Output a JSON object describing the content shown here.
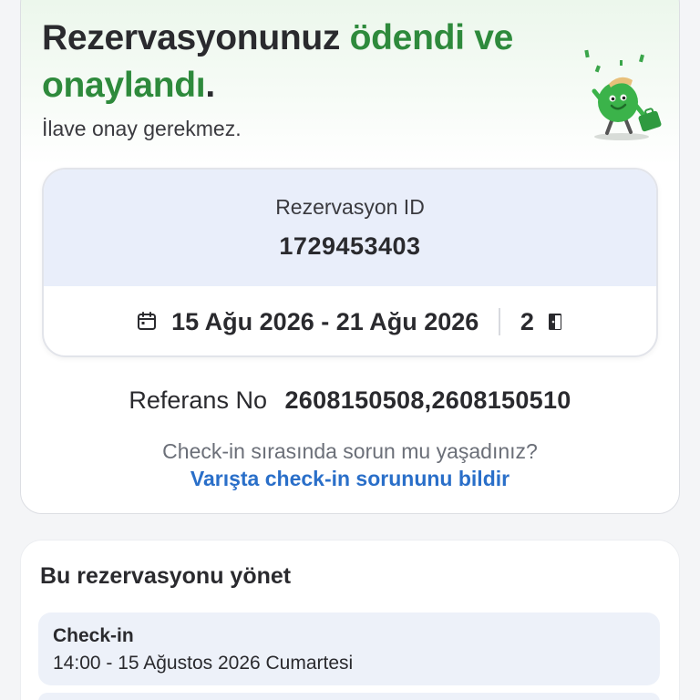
{
  "confirmation": {
    "headline_part1": "Rezervasyonunuz ",
    "headline_green": "ödendi ve onaylandı",
    "headline_end": ".",
    "subline": "İlave onay gerekmez.",
    "mascot_icon": "happy-mascot-with-suitcase-icon"
  },
  "reservation": {
    "id_label": "Rezervasyon ID",
    "id_value": "1729453403",
    "dates": "15 Ağu 2026 - 21 Ağu 2026",
    "room_count": "2",
    "calendar_icon": "calendar-icon",
    "room_icon": "door-icon"
  },
  "reference": {
    "label": "Referans No",
    "value": "2608150508,2608150510"
  },
  "help": {
    "question": "Check-in sırasında sorun mu yaşadınız?",
    "link": "Varışta check-in sorununu bildir"
  },
  "manage": {
    "title": "Bu rezervasyonu yönet",
    "checkin_title": "Check-in",
    "checkin_time": "14:00 - 15 Ağustos 2026 Cumartesi"
  },
  "colors": {
    "accent_green": "#2e8a3c",
    "link_blue": "#2a6fc9",
    "id_panel": "#e9eefa"
  }
}
